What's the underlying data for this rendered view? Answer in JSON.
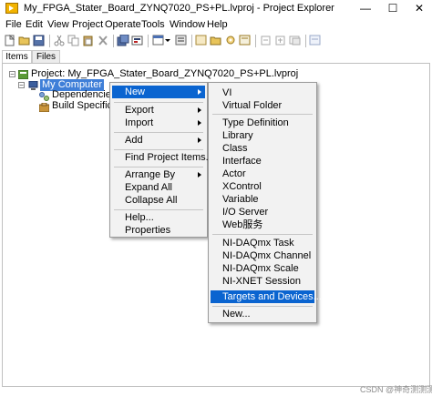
{
  "window": {
    "title": "My_FPGA_Stater_Board_ZYNQ7020_PS+PL.lvproj - Project Explorer",
    "minimize_glyph": "—",
    "maximize_glyph": "☐",
    "close_glyph": "✕"
  },
  "menubar": [
    "File",
    "Edit",
    "View",
    "Project",
    "Operate",
    "Tools",
    "Window",
    "Help"
  ],
  "tabs": [
    "Items",
    "Files"
  ],
  "tree": {
    "expander_minus": "−",
    "root_label": "Project: My_FPGA_Stater_Board_ZYNQ7020_PS+PL.lvproj",
    "computer_label": "My Computer",
    "dependencies_label": "Dependencies",
    "build_label": "Build Specificatio"
  },
  "context_menu": {
    "items": [
      "New",
      "Export",
      "Import",
      "Add",
      "Find Project Items...",
      "Arrange By",
      "Expand All",
      "Collapse All",
      "Help...",
      "Properties"
    ]
  },
  "submenu": {
    "items": [
      "VI",
      "Virtual Folder",
      "Type Definition",
      "Library",
      "Class",
      "Interface",
      "Actor",
      "XControl",
      "Variable",
      "I/O Server",
      "Web服务",
      "NI-DAQmx Task",
      "NI-DAQmx Channel",
      "NI-DAQmx Scale",
      "NI-XNET Session",
      "Targets and Devices...",
      "New..."
    ]
  },
  "watermark": "CSDN @神奇测测测",
  "colors": {
    "highlight": "#0a64d0",
    "selection": "#3f7fd8",
    "menu_background": "#f2f2f2"
  },
  "icons": [
    "labview-app-icon",
    "project-icon",
    "computer-icon",
    "dependencies-icon",
    "build-specifications-icon"
  ]
}
